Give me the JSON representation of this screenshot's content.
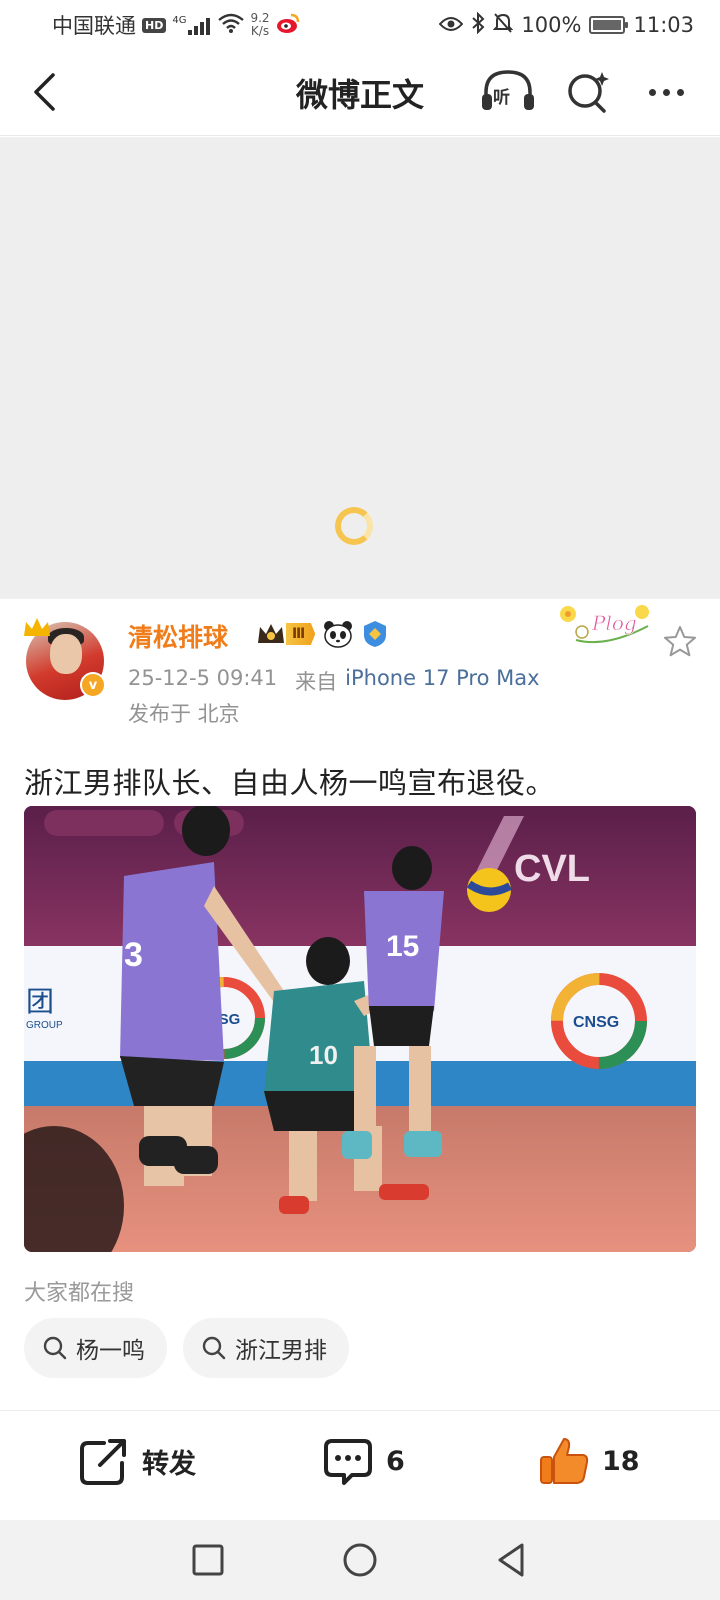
{
  "status_bar": {
    "carrier": "中国联通",
    "hd": "HD",
    "signal": "4G",
    "net_speed_value": "9.2",
    "net_speed_unit": "K/s",
    "battery": "100%",
    "battery_level": 1.0,
    "time": "11:03"
  },
  "title_bar": {
    "title": "微博正文",
    "listen_label": "听"
  },
  "post": {
    "username": "清松排球",
    "vip_level": "Ⅲ",
    "timestamp": "25-12-5 09:41",
    "source_prefix": "来自",
    "device": "iPhone 17 Pro Max",
    "location": "发布于 北京",
    "sticker_text": "Plog",
    "text": "浙江男排队长、自由人杨一鸣宣布退役。",
    "image_signage": [
      "CVL",
      "CNSG",
      "团",
      "GROUP"
    ],
    "jersey_numbers": [
      "3",
      "10",
      "15"
    ]
  },
  "search": {
    "label": "大家都在搜",
    "chips": [
      "杨一鸣",
      "浙江男排"
    ]
  },
  "actions": {
    "repost_label": "转发",
    "comment_count": "6",
    "like_count": "18"
  },
  "colors": {
    "username": "#f07c1a",
    "device_link": "#4a6f9a",
    "like": "#f07c1a",
    "spinner": "#f6c550"
  }
}
